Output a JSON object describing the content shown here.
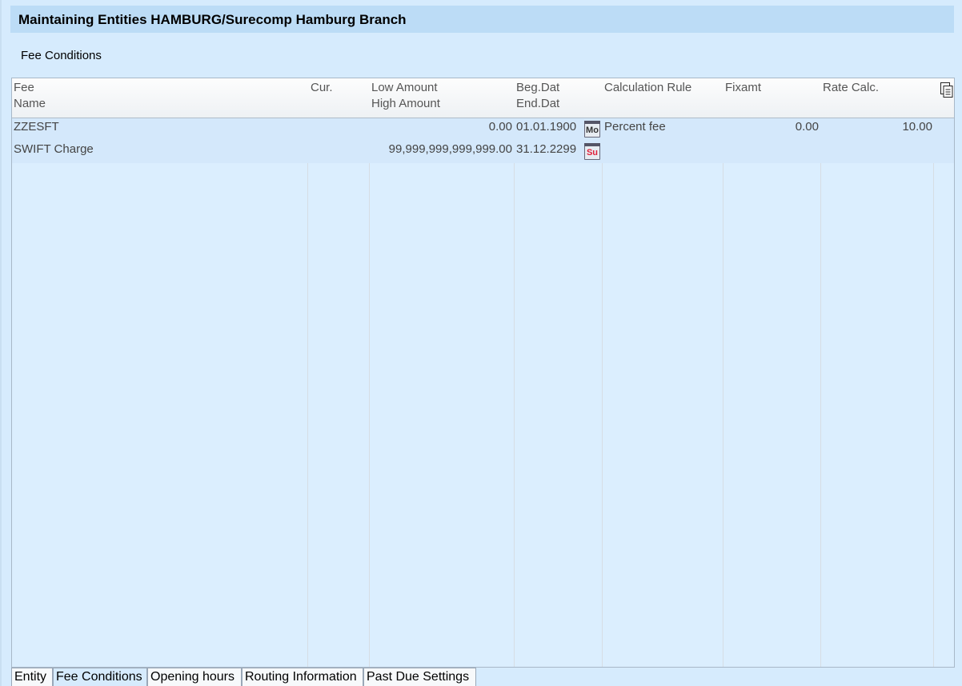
{
  "title": "Maintaining Entities HAMBURG/Surecomp Hamburg Branch",
  "section_label": "Fee Conditions",
  "columns": {
    "fee": "Fee",
    "name": "Name",
    "cur": "Cur.",
    "low_amount": "Low Amount",
    "high_amount": "High Amount",
    "beg_dat": "Beg.Dat",
    "end_dat": "End.Dat",
    "calc_rule": "Calculation Rule",
    "fixamt": "Fixamt",
    "rate_calc": "Rate Calc."
  },
  "rows": [
    {
      "name": "ZZESFT",
      "cur": "",
      "amount": "0.00",
      "date": "01.01.1900",
      "cal_label": "Mo",
      "calc_rule": "Percent fee",
      "fixamt": "0.00",
      "rate_calc": "10.00"
    },
    {
      "name": "SWIFT Charge",
      "cur": "",
      "amount": "99,999,999,999,999.00",
      "date": "31.12.2299",
      "cal_label": "Su",
      "calc_rule": "",
      "fixamt": "",
      "rate_calc": ""
    }
  ],
  "tabs": [
    "Entity",
    "Fee Conditions",
    "Opening hours",
    "Routing Information",
    "Past Due Settings"
  ],
  "active_tab": "Fee Conditions",
  "icons": {
    "export": "copy-document-icon",
    "calendar": "calendar-icon"
  },
  "colors": {
    "background": "#d6ebfd",
    "title_bar": "#bcdcf6",
    "sunday_red": "#e0203a"
  }
}
